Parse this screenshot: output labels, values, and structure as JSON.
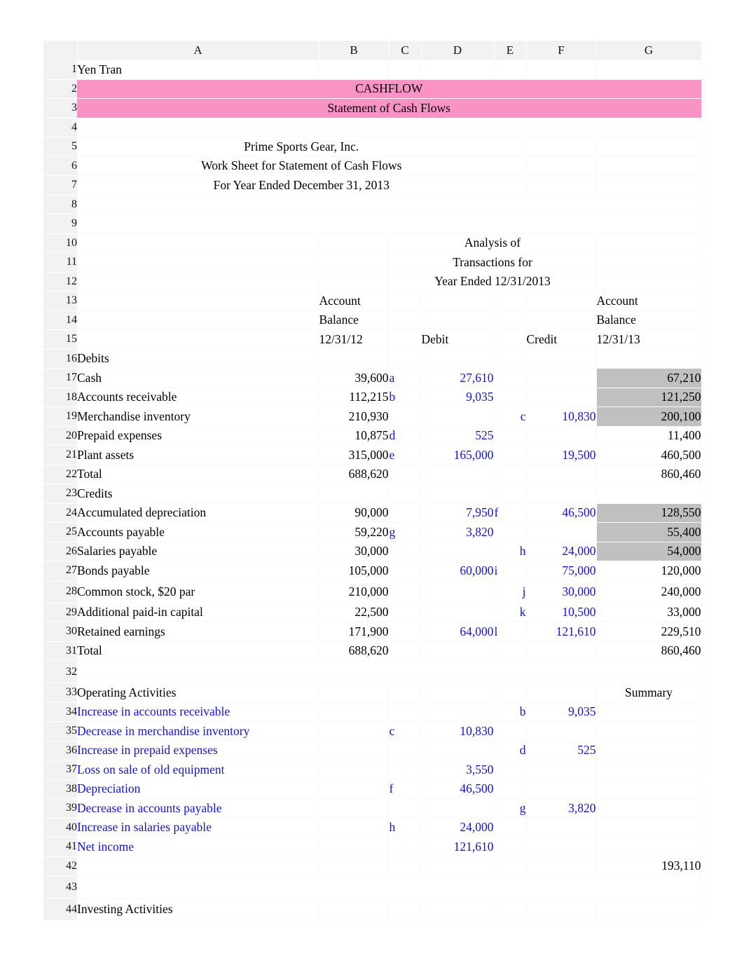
{
  "sheet": {
    "column_headers": [
      "A",
      "B",
      "C",
      "D",
      "E",
      "F",
      "G"
    ],
    "row_numbers": [
      1,
      2,
      3,
      4,
      5,
      6,
      7,
      8,
      9,
      10,
      11,
      12,
      13,
      14,
      15,
      16,
      17,
      18,
      19,
      20,
      21,
      22,
      23,
      24,
      25,
      26,
      27,
      28,
      29,
      30,
      31,
      32,
      33,
      34,
      35,
      36,
      37,
      38,
      39,
      40,
      41,
      42,
      43,
      44
    ],
    "colors": {
      "accent_pink": "#f992c5",
      "shade_gray": "#c0c0c0",
      "entry_blue": "#1414d2",
      "header_gray": "#f2f2f2"
    }
  },
  "titles": {
    "author": "Yen Tran",
    "banner_line1": "CASHFLOW",
    "banner_line2": "Statement of Cash Flows",
    "company": "Prime Sports Gear, Inc.",
    "worksheet": "Work Sheet for Statement of Cash Flows",
    "period": "For Year Ended December 31, 2013"
  },
  "analysis_header": {
    "line1": "Analysis of",
    "line2": "Transactions for",
    "line3": "Year Ended 12/31/2013",
    "left_col_l1": "Account",
    "left_col_l2": "Balance",
    "left_col_l3": "12/31/12",
    "debit_label": "Debit",
    "credit_label": "Credit",
    "right_col_l1": "Account",
    "right_col_l2": "Balance",
    "right_col_l3": "12/31/13"
  },
  "sections": {
    "debits_label": "Debits",
    "credits_label": "Credits",
    "total_label": "Total",
    "operating_label": "Operating Activities",
    "summary_label": "Summary",
    "investing_label": "Investing Activities"
  },
  "debits": [
    {
      "row": 17,
      "name": "Cash",
      "bal12": "39,600",
      "dkey": "a",
      "debit": "27,610",
      "ckey": "",
      "credit": "",
      "bal13": "67,210",
      "shaded": true
    },
    {
      "row": 18,
      "name": "Accounts receivable",
      "bal12": "112,215",
      "dkey": "b",
      "debit": "9,035",
      "ckey": "",
      "credit": "",
      "bal13": "121,250",
      "shaded": true
    },
    {
      "row": 19,
      "name": "Merchandise inventory",
      "bal12": "210,930",
      "dkey": "",
      "debit": "",
      "ckey": "c",
      "credit": "10,830",
      "bal13": "200,100",
      "shaded": true
    },
    {
      "row": 20,
      "name": "Prepaid expenses",
      "bal12": "10,875",
      "dkey": "d",
      "debit": "525",
      "ckey": "",
      "credit": "",
      "bal13": "11,400",
      "shaded": false
    },
    {
      "row": 21,
      "name": "Plant assets",
      "bal12": "315,000",
      "dkey": "e",
      "debit": "165,000",
      "ckey": "",
      "credit": "19,500",
      "bal13": "460,500",
      "shaded": false
    }
  ],
  "debits_total": {
    "row": 22,
    "label": "Total",
    "bal12": "688,620",
    "bal13": "860,460"
  },
  "credits": [
    {
      "row": 24,
      "name": "Accumulated depreciation",
      "bal12": "90,000",
      "debit": "7,950",
      "dkey": "f",
      "credit": "46,500",
      "bal13": "128,550",
      "shaded": true,
      "key_pos": "E"
    },
    {
      "row": 25,
      "name": "Accounts payable",
      "bal12": "59,220",
      "debit": "3,820",
      "dkey": "g",
      "credit": "",
      "bal13": "55,400",
      "shaded": true,
      "key_pos": "C"
    },
    {
      "row": 26,
      "name": "Salaries payable",
      "bal12": "30,000",
      "debit": "",
      "dkey": "h",
      "credit": "24,000",
      "bal13": "54,000",
      "shaded": true,
      "key_pos": "E"
    },
    {
      "row": 27,
      "name": "Bonds payable",
      "bal12": "105,000",
      "debit": "60,000",
      "dkey": "i",
      "credit": "75,000",
      "bal13": "120,000",
      "shaded": false,
      "key_pos": "E"
    },
    {
      "row": 28,
      "name": "Common stock, $20 par",
      "bal12": "210,000",
      "debit": "",
      "dkey": "j",
      "credit": "30,000",
      "bal13": "240,000",
      "shaded": false,
      "key_pos": "E"
    },
    {
      "row": 29,
      "name": "Additional paid-in capital",
      "bal12": "22,500",
      "debit": "",
      "dkey": "k",
      "credit": "10,500",
      "bal13": "33,000",
      "shaded": false,
      "key_pos": "E"
    },
    {
      "row": 30,
      "name": "Retained earnings",
      "bal12": "171,900",
      "debit": "64,000",
      "dkey": "l",
      "credit": "121,610",
      "bal13": "229,510",
      "shaded": false,
      "key_pos": "E"
    }
  ],
  "credits_total": {
    "row": 31,
    "label": "Total",
    "bal12": "688,620",
    "bal13": "860,460"
  },
  "operating": [
    {
      "row": 34,
      "name": "Increase in accounts receivable",
      "ckey": "",
      "cval": "",
      "ekey": "b",
      "fval": "9,035"
    },
    {
      "row": 35,
      "name": "Decrease in merchandise inventory",
      "ckey": "c",
      "cval": "10,830",
      "ekey": "",
      "fval": ""
    },
    {
      "row": 36,
      "name": "Increase in prepaid expenses",
      "ckey": "",
      "cval": "",
      "ekey": "d",
      "fval": "525"
    },
    {
      "row": 37,
      "name": "Loss on sale of old equipment",
      "ckey": "",
      "cval": "3,550",
      "ekey": "",
      "fval": ""
    },
    {
      "row": 38,
      "name": "Depreciation",
      "ckey": "f",
      "cval": "46,500",
      "ekey": "",
      "fval": ""
    },
    {
      "row": 39,
      "name": "Decrease in accounts payable",
      "ckey": "",
      "cval": "",
      "ekey": "g",
      "fval": "3,820"
    },
    {
      "row": 40,
      "name": "Increase in salaries payable",
      "ckey": "h",
      "cval": "24,000",
      "ekey": "",
      "fval": ""
    },
    {
      "row": 41,
      "name": "Net income",
      "ckey": "",
      "cval": "121,610",
      "ekey": "",
      "fval": ""
    }
  ],
  "operating_summary": {
    "row": 42,
    "value": "193,110"
  }
}
